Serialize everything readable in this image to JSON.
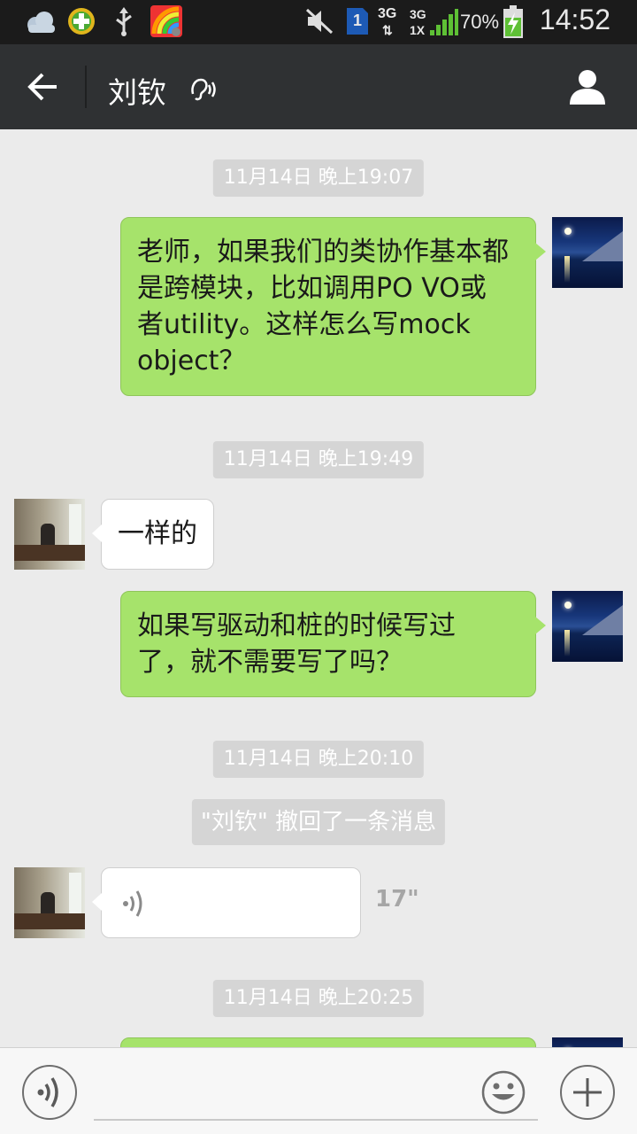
{
  "status_bar": {
    "time": "14:52",
    "battery_percent": "70%",
    "network_primary": "3G",
    "network_secondary_top": "3G",
    "network_secondary_bottom": "1X",
    "sim_badge": "1",
    "icons": [
      "weather-cloud-icon",
      "plus-app-icon",
      "usb-icon",
      "color-app-icon",
      "mute-icon",
      "sim-icon",
      "signal-icon",
      "battery-charging-icon"
    ]
  },
  "header": {
    "back_label": "back",
    "contact_name": "刘钦",
    "earpiece_mode_icon": "earpiece-icon",
    "profile_icon": "person-icon"
  },
  "messages": [
    {
      "type": "timestamp",
      "text": "11月14日 晚上19:07"
    },
    {
      "type": "text",
      "sender": "self",
      "lines": [
        "老师，如果我们的类协作基本都",
        "是跨模块，比如调用PO VO或",
        "者utility。这样怎么写mock",
        "object？"
      ]
    },
    {
      "type": "timestamp",
      "text": "11月14日 晚上19:49"
    },
    {
      "type": "text",
      "sender": "other",
      "lines": [
        "一样的"
      ]
    },
    {
      "type": "text",
      "sender": "self",
      "lines": [
        "如果写驱动和桩的时候写过",
        "了，就不需要写了吗？"
      ]
    },
    {
      "type": "timestamp",
      "text": "11月14日 晚上20:10"
    },
    {
      "type": "system",
      "text": "\"刘钦\" 撤回了一条消息"
    },
    {
      "type": "voice",
      "sender": "other",
      "duration": "17\""
    },
    {
      "type": "timestamp",
      "text": "11月14日 晚上20:25"
    }
  ],
  "input_bar": {
    "placeholder": "",
    "voice_icon": "voice-input-icon",
    "emoji_icon": "emoji-icon",
    "plus_icon": "plus-icon"
  }
}
